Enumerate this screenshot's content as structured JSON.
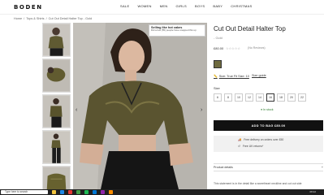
{
  "brand": "BODEN",
  "nav": [
    "SALE",
    "WOMEN",
    "MEN",
    "GIRLS",
    "BOYS",
    "BABY",
    "CHRISTMAS"
  ],
  "breadcrumb": [
    "Home",
    "/",
    "Tops & Shirts",
    "/",
    "Cut Out Detail Halter Top - Gold"
  ],
  "badge": {
    "title": "Selling like hot cakes",
    "text": "Did a few (55) people have snapped this up"
  },
  "product": {
    "title": "Cut Out Detail Halter Top",
    "subtitle": "- Gold",
    "price": "£80.00",
    "stars": "☆☆☆☆☆",
    "reviews": "(No Reviews)",
    "swatch_color": "#6e6a3f",
    "size_guide": "Size: True Fit Size: 10",
    "size_guide_link": "Size guide",
    "size_label": "Size",
    "sizes": [
      "6",
      "8",
      "10",
      "12",
      "14",
      "16",
      "18",
      "20",
      "22"
    ],
    "selected_size": "16",
    "stock": "● In stock",
    "add_button": "ADD TO BAG £80.00",
    "delivery1": "Free delivery on orders over £50",
    "delivery2": "Free UK returns*",
    "details_label": "Product details",
    "details_toggle": "+",
    "description": "This statement is in the detail like a sweetheart neckline and cut out side"
  },
  "icons": {
    "prev_arrow": "‹",
    "next_arrow": "›",
    "ruler": "📏",
    "truck": "🚚",
    "return": "↺"
  },
  "taskbar": {
    "search_placeholder": "Type here to search",
    "time": "08:22"
  }
}
